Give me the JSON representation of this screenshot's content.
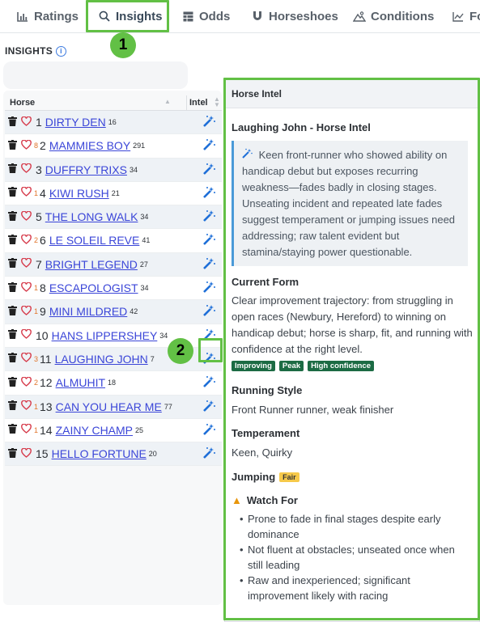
{
  "tabs": [
    {
      "label": "Ratings",
      "icon": "bar-chart-icon"
    },
    {
      "label": "Insights",
      "icon": "search-icon"
    },
    {
      "label": "Odds",
      "icon": "table-icon"
    },
    {
      "label": "Horseshoes",
      "icon": "horseshoe-icon"
    },
    {
      "label": "Conditions",
      "icon": "terrain-icon"
    },
    {
      "label": "Fo",
      "icon": "line-chart-icon"
    }
  ],
  "callouts": {
    "one": "1",
    "two": "2"
  },
  "section": {
    "title": "INSIGHTS"
  },
  "table": {
    "headers": {
      "horse": "Horse",
      "intel": "Intel"
    },
    "rows": [
      {
        "odds_sup": "",
        "num": "1",
        "name": "DIRTY DEN",
        "sup": "16"
      },
      {
        "odds_sup": "8",
        "num": "2",
        "name": "MAMMIES BOY",
        "sup": "291"
      },
      {
        "odds_sup": "",
        "num": "3",
        "name": "DUFFRY TRIXS",
        "sup": "34"
      },
      {
        "odds_sup": "1",
        "num": "4",
        "name": "KIWI RUSH",
        "sup": "21"
      },
      {
        "odds_sup": "",
        "num": "5",
        "name": "THE LONG WALK",
        "sup": "34"
      },
      {
        "odds_sup": "2",
        "num": "6",
        "name": "LE SOLEIL REVE",
        "sup": "41"
      },
      {
        "odds_sup": "",
        "num": "7",
        "name": "BRIGHT LEGEND",
        "sup": "27"
      },
      {
        "odds_sup": "1",
        "num": "8",
        "name": "ESCAPOLOGIST",
        "sup": "34"
      },
      {
        "odds_sup": "1",
        "num": "9",
        "name": "MINI MILDRED",
        "sup": "42"
      },
      {
        "odds_sup": "",
        "num": "10",
        "name": "HANS LIPPERSHEY",
        "sup": "34"
      },
      {
        "odds_sup": "3",
        "num": "11",
        "name": "LAUGHING JOHN",
        "sup": "7"
      },
      {
        "odds_sup": "2",
        "num": "12",
        "name": "ALMUHIT",
        "sup": "18"
      },
      {
        "odds_sup": "1",
        "num": "13",
        "name": "CAN YOU HEAR ME",
        "sup": "77"
      },
      {
        "odds_sup": "1",
        "num": "14",
        "name": "ZAINY CHAMP",
        "sup": "25"
      },
      {
        "odds_sup": "",
        "num": "15",
        "name": "HELLO FORTUNE",
        "sup": "20"
      }
    ]
  },
  "panel": {
    "header": "Horse Intel",
    "title": "Laughing John - Horse Intel",
    "summary": "Keen front-runner who showed ability on handicap debut but exposes recurring weakness—fades badly in closing stages. Unseating incident and repeated late fades suggest temperament or jumping issues need addressing; raw talent evident but stamina/staying power questionable.",
    "current_form_title": "Current Form",
    "current_form_text": "Clear improvement trajectory: from struggling in open races (Newbury, Hereford) to winning on handicap debut; horse is sharp, fit, and running with confidence at the right level.",
    "tags": [
      "Improving",
      "Peak",
      "High confidence"
    ],
    "running_style_title": "Running Style",
    "running_style_text": "Front Runner runner, weak finisher",
    "temperament_title": "Temperament",
    "temperament_text": "Keen, Quirky",
    "jumping_title": "Jumping",
    "jumping_rating": "Fair",
    "watch_title": "Watch For",
    "watch_items": [
      "Prone to fade in final stages despite early dominance",
      "Not fluent at obstacles; unseated once when still leading",
      "Raw and inexperienced; significant improvement likely with racing"
    ]
  },
  "colors": {
    "highlight": "#62c045",
    "link": "#3b46d8",
    "tag": "#1c6b44",
    "accent": "#1e6fd8"
  }
}
